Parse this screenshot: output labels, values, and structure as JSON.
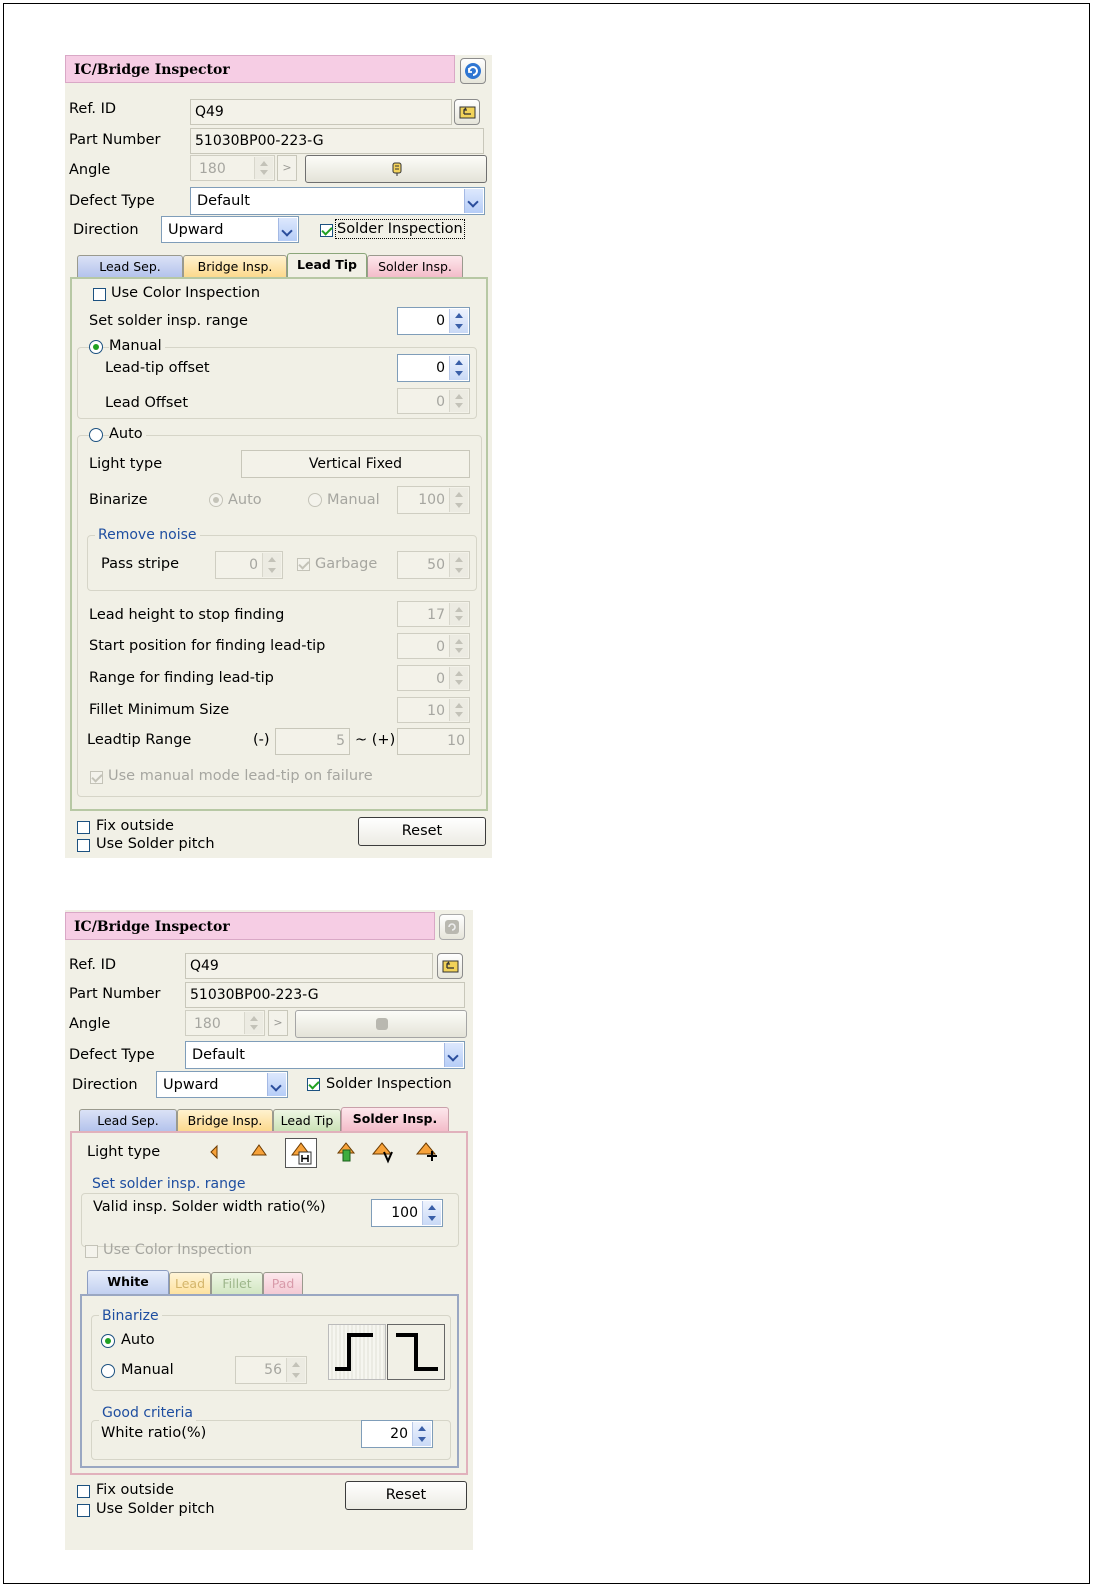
{
  "panel1": {
    "title": "IC/Bridge Inspector",
    "ref_id_label": "Ref. ID",
    "ref_id_value": "Q49",
    "part_number_label": "Part Number",
    "part_number_value": "51030BP00-223-G",
    "angle_label": "Angle",
    "angle_value": "180",
    "angle_next": ">",
    "defect_type_label": "Defect Type",
    "defect_type_value": "Default",
    "direction_label": "Direction",
    "direction_value": "Upward",
    "solder_inspection_label": "Solder Inspection",
    "tabs": [
      "Lead Sep.",
      "Bridge Insp.",
      "Lead Tip",
      "Solder Insp."
    ],
    "use_color_inspection": "Use Color Inspection",
    "set_solder_range_label": "Set solder insp. range",
    "set_solder_range_value": "0",
    "manual_label": "Manual",
    "lead_tip_offset_label": "Lead-tip offset",
    "lead_tip_offset_value": "0",
    "lead_offset_label": "Lead Offset",
    "lead_offset_value": "0",
    "auto_label": "Auto",
    "light_type_label": "Light type",
    "light_type_value": "Vertical Fixed",
    "binarize_label": "Binarize",
    "binarize_auto": "Auto",
    "binarize_manual": "Manual",
    "binarize_value": "100",
    "remove_noise_label": "Remove noise",
    "pass_stripe_label": "Pass stripe",
    "pass_stripe_value": "0",
    "garbage_label": "Garbage",
    "garbage_value": "50",
    "lead_height_label": "Lead height to stop finding",
    "lead_height_value": "17",
    "start_position_label": "Start position for finding lead-tip",
    "start_position_value": "0",
    "range_finding_label": "Range for finding lead-tip",
    "range_finding_value": "0",
    "fillet_min_label": "Fillet Minimum Size",
    "fillet_min_value": "10",
    "leadtip_range_label": "Leadtip Range",
    "leadtip_minus": "(-)",
    "leadtip_minus_value": "5",
    "leadtip_plus": "~ (+)",
    "leadtip_plus_value": "10",
    "use_manual_mode_label": "Use manual mode lead-tip on  failure",
    "fix_outside": "Fix outside",
    "use_solder_pitch": "Use Solder pitch",
    "reset": "Reset"
  },
  "panel2": {
    "title": "IC/Bridge Inspector",
    "ref_id_label": "Ref. ID",
    "ref_id_value": "Q49",
    "part_number_label": "Part Number",
    "part_number_value": "51030BP00-223-G",
    "angle_label": "Angle",
    "angle_value": "180",
    "angle_next": ">",
    "defect_type_label": "Defect Type",
    "defect_type_value": "Default",
    "direction_label": "Direction",
    "direction_value": "Upward",
    "solder_inspection_label": "Solder Inspection",
    "tabs": [
      "Lead Sep.",
      "Bridge Insp.",
      "Lead Tip",
      "Solder Insp."
    ],
    "light_type_label": "Light type",
    "set_solder_range_title": "Set solder insp. range",
    "valid_width_label": "Valid insp. Solder width ratio(%)",
    "valid_width_value": "100",
    "use_color_inspection": "Use Color Inspection",
    "subtabs": [
      "White",
      "Lead",
      "Fillet",
      "Pad"
    ],
    "binarize_title": "Binarize",
    "auto_label": "Auto",
    "manual_label": "Manual",
    "manual_value": "56",
    "good_criteria_title": "Good criteria",
    "white_ratio_label": "White ratio(%)",
    "white_ratio_value": "20",
    "fix_outside": "Fix outside",
    "use_solder_pitch": "Use Solder pitch",
    "reset": "Reset"
  },
  "colors": {
    "title_bg": "#f6cde4",
    "panel_bg": "#f1f0e6",
    "group_title": "#1e4ea0",
    "check_green": "#21a121",
    "tab_lead_sep": "#c4cff0",
    "tab_bridge": "#fde2a8",
    "tab_lead_tip": "#d2e8c4",
    "tab_solder": "#f6cfd8"
  }
}
